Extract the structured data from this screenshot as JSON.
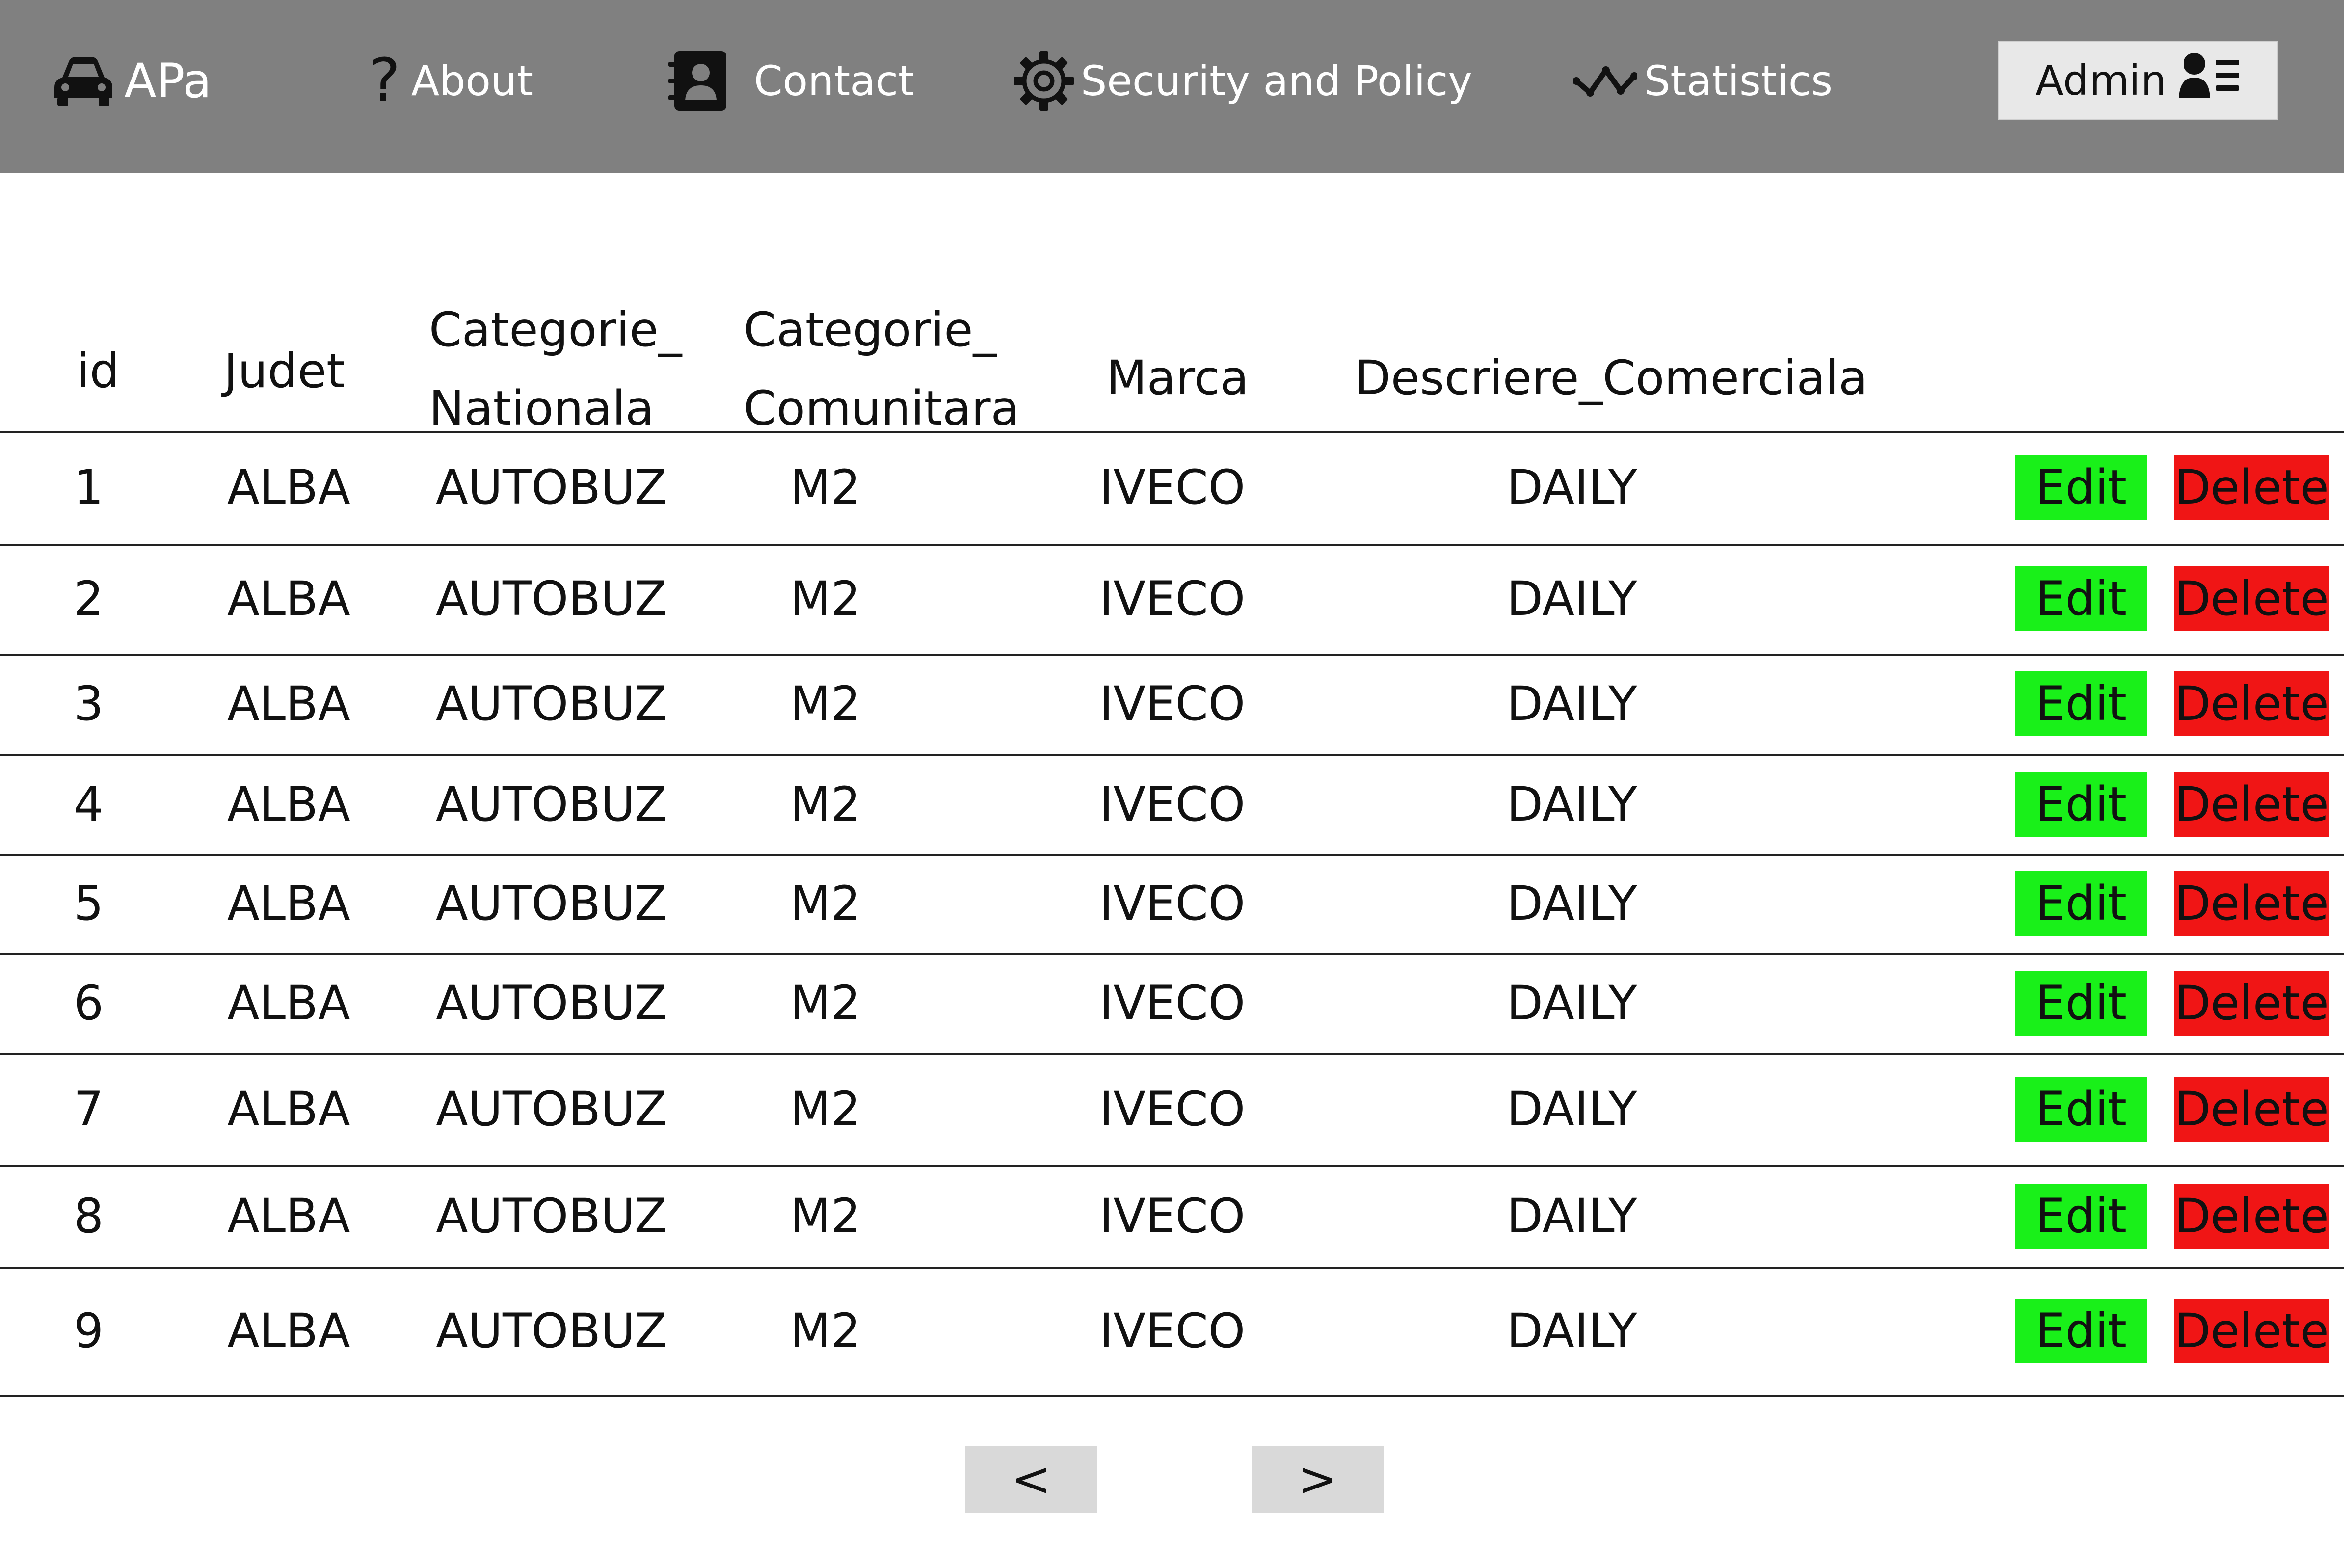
{
  "nav": {
    "brand": "APa",
    "brand_icon": "car-icon",
    "items": [
      {
        "label": "About",
        "icon": "question-icon"
      },
      {
        "label": "Contact",
        "icon": "contact-book-icon"
      },
      {
        "label": "Security and Policy",
        "icon": "gear-icon"
      },
      {
        "label": "Statistics",
        "icon": "trend-line-icon"
      }
    ],
    "admin": {
      "label": "Admin",
      "icon": "user-list-icon"
    }
  },
  "colors": {
    "navbar": "#808080",
    "edit": "#19f019",
    "delete": "#f01515",
    "pager": "#d9d9d9"
  },
  "table": {
    "headers": [
      "id",
      "Judet",
      "Categorie_\nNationala",
      "Categorie_\nComunitara",
      "Marca",
      "Descriere_Comerciala"
    ],
    "rows": [
      [
        "1",
        "ALBA",
        "AUTOBUZ",
        "M2",
        "IVECO",
        "DAILY"
      ],
      [
        "2",
        "ALBA",
        "AUTOBUZ",
        "M2",
        "IVECO",
        "DAILY"
      ],
      [
        "3",
        "ALBA",
        "AUTOBUZ",
        "M2",
        "IVECO",
        "DAILY"
      ],
      [
        "4",
        "ALBA",
        "AUTOBUZ",
        "M2",
        "IVECO",
        "DAILY"
      ],
      [
        "5",
        "ALBA",
        "AUTOBUZ",
        "M2",
        "IVECO",
        "DAILY"
      ],
      [
        "6",
        "ALBA",
        "AUTOBUZ",
        "M2",
        "IVECO",
        "DAILY"
      ],
      [
        "7",
        "ALBA",
        "AUTOBUZ",
        "M2",
        "IVECO",
        "DAILY"
      ],
      [
        "8",
        "ALBA",
        "AUTOBUZ",
        "M2",
        "IVECO",
        "DAILY"
      ],
      [
        "9",
        "ALBA",
        "AUTOBUZ",
        "M2",
        "IVECO",
        "DAILY"
      ]
    ],
    "edit_label": "Edit",
    "delete_label": "Delete"
  },
  "pagination": {
    "prev": "<",
    "next": ">"
  }
}
